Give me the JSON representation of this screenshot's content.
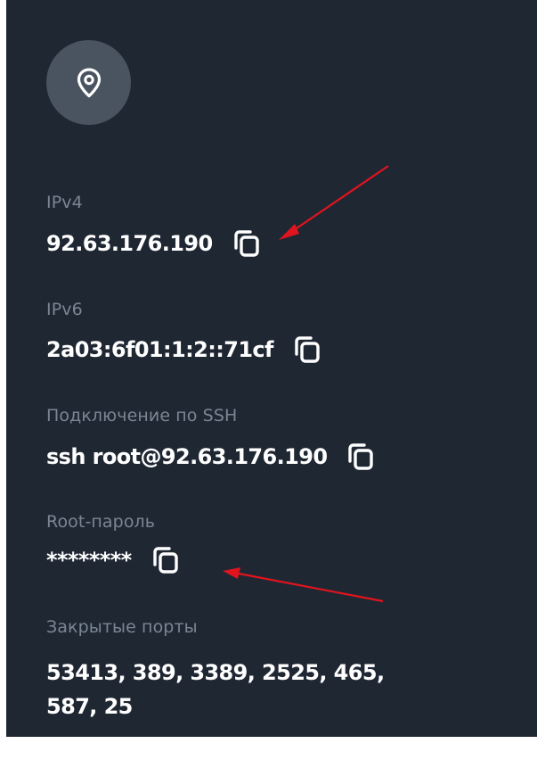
{
  "icons": {
    "location": "map-pin-icon",
    "copy": "copy-icon"
  },
  "colors": {
    "panel_bg": "#1f2733",
    "label": "#7b8694",
    "value": "#ffffff",
    "icon_circle": "#4a5461",
    "annotation_arrow": "#e0141e"
  },
  "fields": {
    "ipv4": {
      "label": "IPv4",
      "value": "92.63.176.190"
    },
    "ipv6": {
      "label": "IPv6",
      "value": "2a03:6f01:1:2::71cf"
    },
    "ssh": {
      "label": "Подключение по SSH",
      "value": "ssh root@92.63.176.190"
    },
    "root_password": {
      "label": "Root-пароль",
      "value": "********"
    },
    "closed_ports": {
      "label": "Закрытые порты",
      "value": "53413, 389, 3389, 2525, 465, 587, 25"
    }
  }
}
